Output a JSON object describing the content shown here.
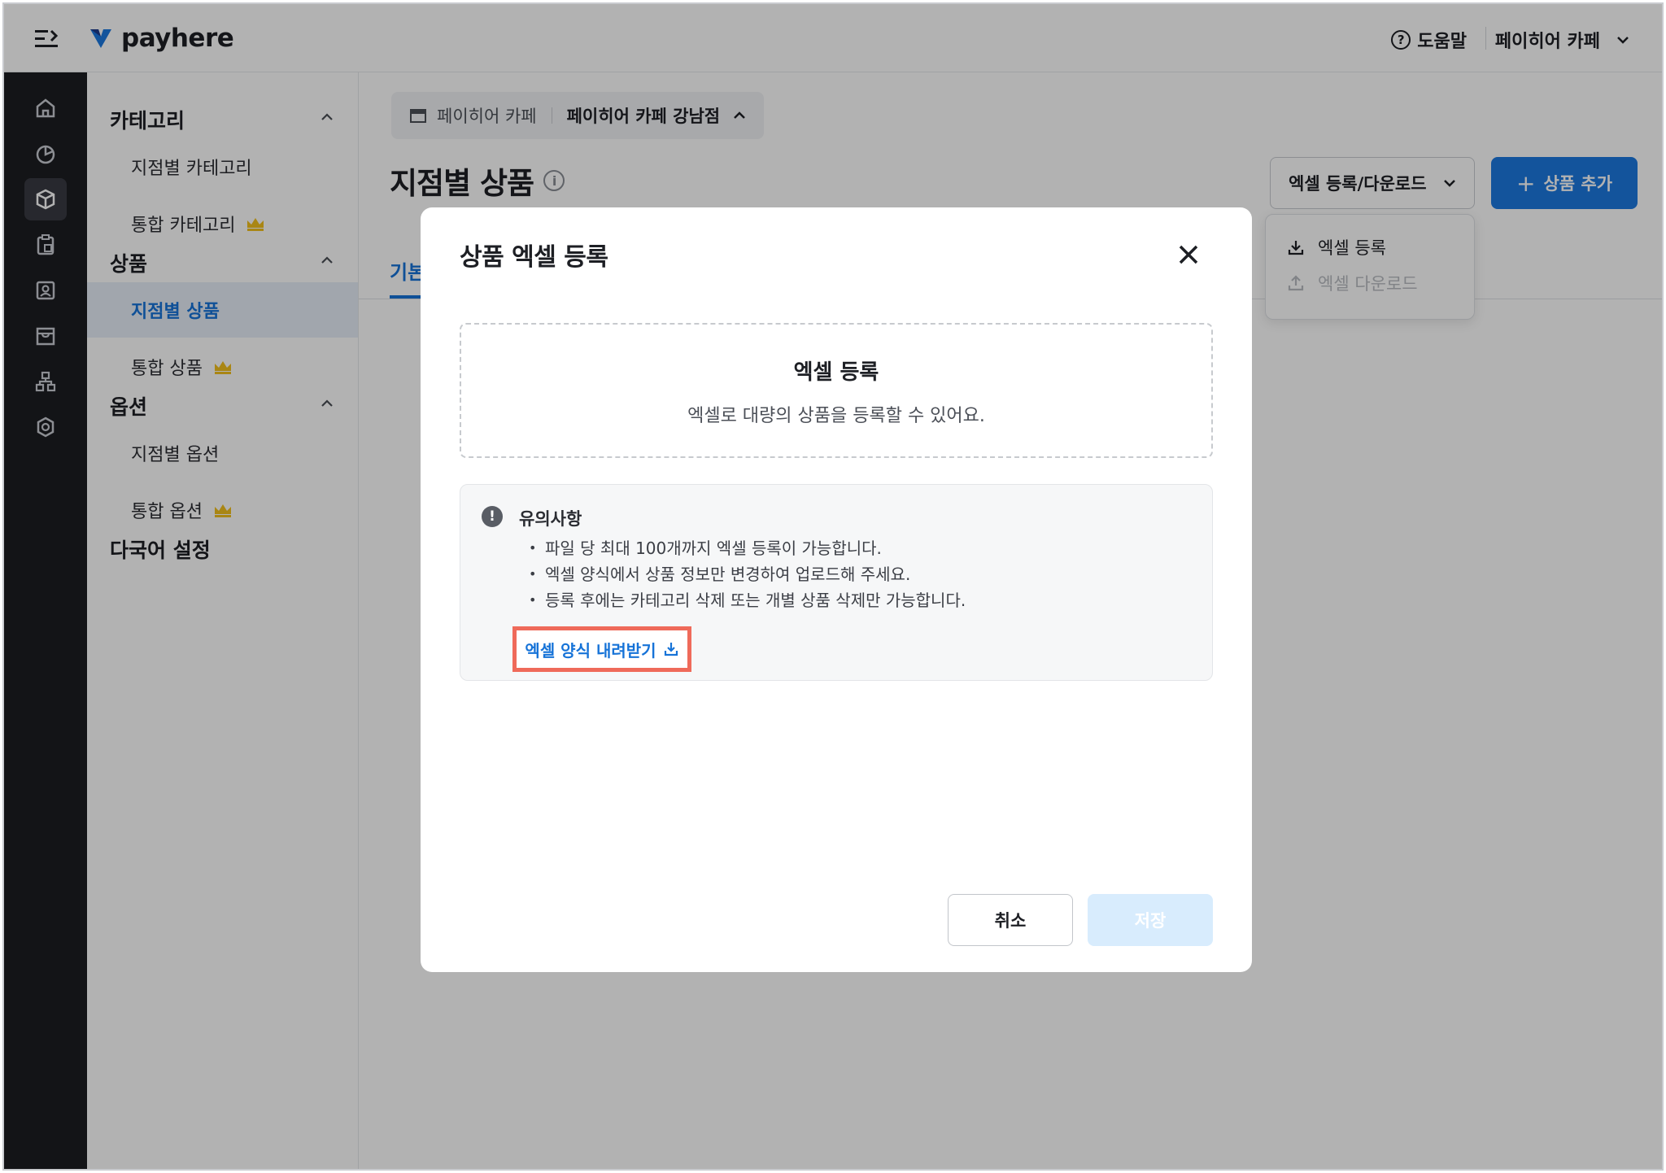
{
  "topbar": {
    "brand": "payhere",
    "help_label": "도움말",
    "store_name": "페이히어 카페"
  },
  "rail": {
    "items": [
      "home-icon",
      "chart-pie-icon",
      "box-icon",
      "clipboard-icon",
      "contact-icon",
      "store-icon",
      "org-chart-icon",
      "settings-icon"
    ],
    "active": "box-icon"
  },
  "sidebar": {
    "category": {
      "title": "카테고리",
      "items": [
        {
          "label": "지점별 카테고리",
          "premium": false
        },
        {
          "label": "통합 카테고리",
          "premium": true
        }
      ]
    },
    "product": {
      "title": "상품",
      "items": [
        {
          "label": "지점별 상품",
          "premium": false,
          "active": true
        },
        {
          "label": "통합 상품",
          "premium": true
        }
      ]
    },
    "option": {
      "title": "옵션",
      "items": [
        {
          "label": "지점별 옵션",
          "premium": false
        },
        {
          "label": "통합 옵션",
          "premium": true
        }
      ]
    },
    "language": {
      "title": "다국어 설정"
    }
  },
  "content": {
    "breadcrumb": {
      "store": "페이히어 카페",
      "branch": "페이히어 카페 강남점"
    },
    "page_title": "지점별 상품",
    "tab_basic": "기본",
    "excel_dropdown_label": "엑셀 등록/다운로드",
    "add_button_label": "상품 추가",
    "dropdown_menu": {
      "register": "엑셀 등록",
      "download": "엑셀 다운로드"
    }
  },
  "modal": {
    "title": "상품 엑셀 등록",
    "dropzone": {
      "title": "엑셀 등록",
      "description": "엑셀로 대량의 상품을 등록할 수 있어요."
    },
    "notice": {
      "title": "유의사항",
      "items": [
        "파일 당 최대 100개까지 엑셀 등록이 가능합니다.",
        "엑셀 양식에서 상품 정보만 변경하여 업로드해 주세요.",
        "등록 후에는 카테고리 삭제 또는 개별 상품 삭제만 가능합니다."
      ],
      "download_link": "엑셀 양식 내려받기"
    },
    "cancel_label": "취소",
    "save_label": "저장"
  },
  "colors": {
    "accent": "#1c79e0",
    "rail_bg": "#1c1d22",
    "highlight_border": "#ef6a5a",
    "crown": "#f2c01e"
  }
}
